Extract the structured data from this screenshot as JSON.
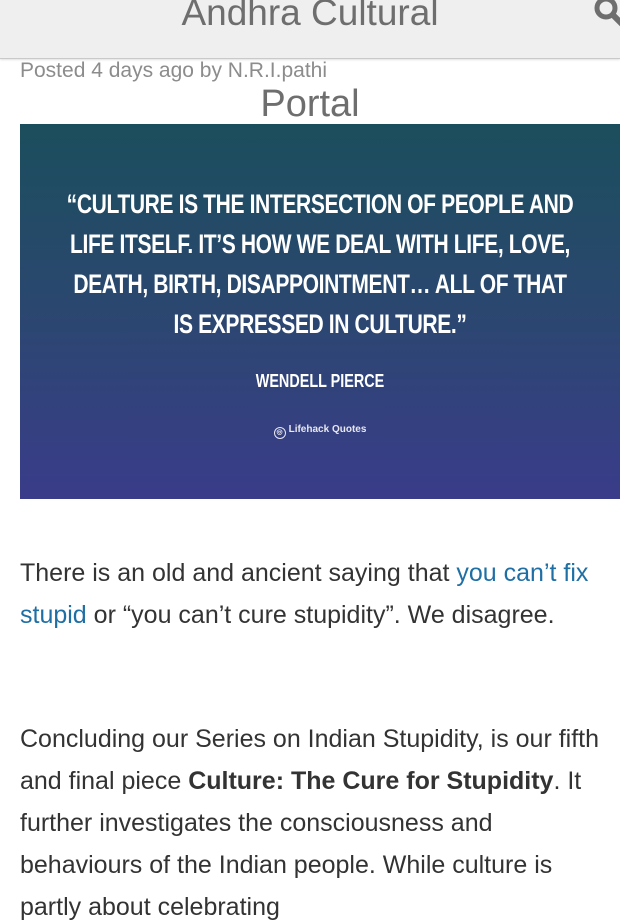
{
  "header": {
    "site_title": "Andhra Cultural",
    "site_title_cont": "Portal"
  },
  "post": {
    "meta": "Posted 4 days ago by N.R.I.pathi"
  },
  "quote_image": {
    "quote": "“CULTURE IS THE INTERSECTION OF PEOPLE AND LIFE ITSELF. IT’S HOW WE DEAL WITH LIFE, LOVE, DEATH, BIRTH, DISAPPOINTMENT… ALL OF THAT IS EXPRESSED IN CULTURE.”",
    "author": "WENDELL PIERCE",
    "source": "Lifehack Quotes",
    "gradient_top": "#1b4e5d",
    "gradient_bottom": "#3a3c8a"
  },
  "body": {
    "p1_a": "There is an old and ancient saying that ",
    "p1_link": "you can’t fix stupid",
    "p1_b": " or “you can’t cure stupidity”. We disagree.",
    "p2_a": "Concluding our Series on Indian Stupidity, is our fifth and final  piece ",
    "p2_bold": "Culture: The Cure for Stupidity",
    "p2_b": ". It further investigates the consciousness and behaviours of the Indian people. While culture is partly about celebrating"
  },
  "colors": {
    "link": "#1f6fa5",
    "text": "#333333",
    "header_bg": "#efefef"
  }
}
